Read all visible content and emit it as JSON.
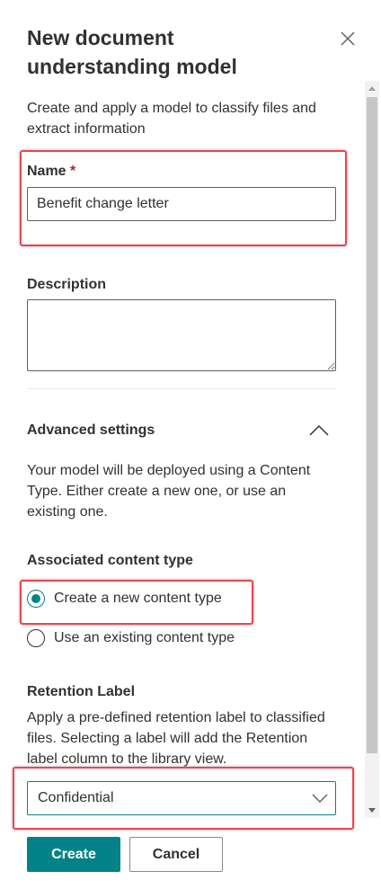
{
  "panel": {
    "title": "New document understanding model",
    "close_label": "Close"
  },
  "intro": "Create and apply a model to classify files and extract information",
  "name_field": {
    "label": "Name",
    "required_marker": "*",
    "value": "Benefit change letter"
  },
  "description_field": {
    "label": "Description",
    "value": ""
  },
  "advanced": {
    "header": "Advanced settings",
    "expanded": true,
    "description": "Your model will be deployed using a Content Type. Either create a new one, or use an existing one."
  },
  "content_type": {
    "label": "Associated content type",
    "options": [
      {
        "label": "Create a new content type",
        "checked": true
      },
      {
        "label": "Use an existing content type",
        "checked": false
      }
    ]
  },
  "retention": {
    "label": "Retention Label",
    "description": "Apply a pre-defined retention label to classified files. Selecting a label will add the Retention label column to the library view.",
    "selected": "Confidential"
  },
  "footer": {
    "primary_label": "Create",
    "secondary_label": "Cancel"
  },
  "colors": {
    "accent": "#038387",
    "required": "#a4262c",
    "highlight": "#e8474f",
    "text": "#323130"
  },
  "icons": {
    "close": "close-icon",
    "collapse": "chevron-up-icon",
    "dropdown": "chevron-down-icon"
  }
}
